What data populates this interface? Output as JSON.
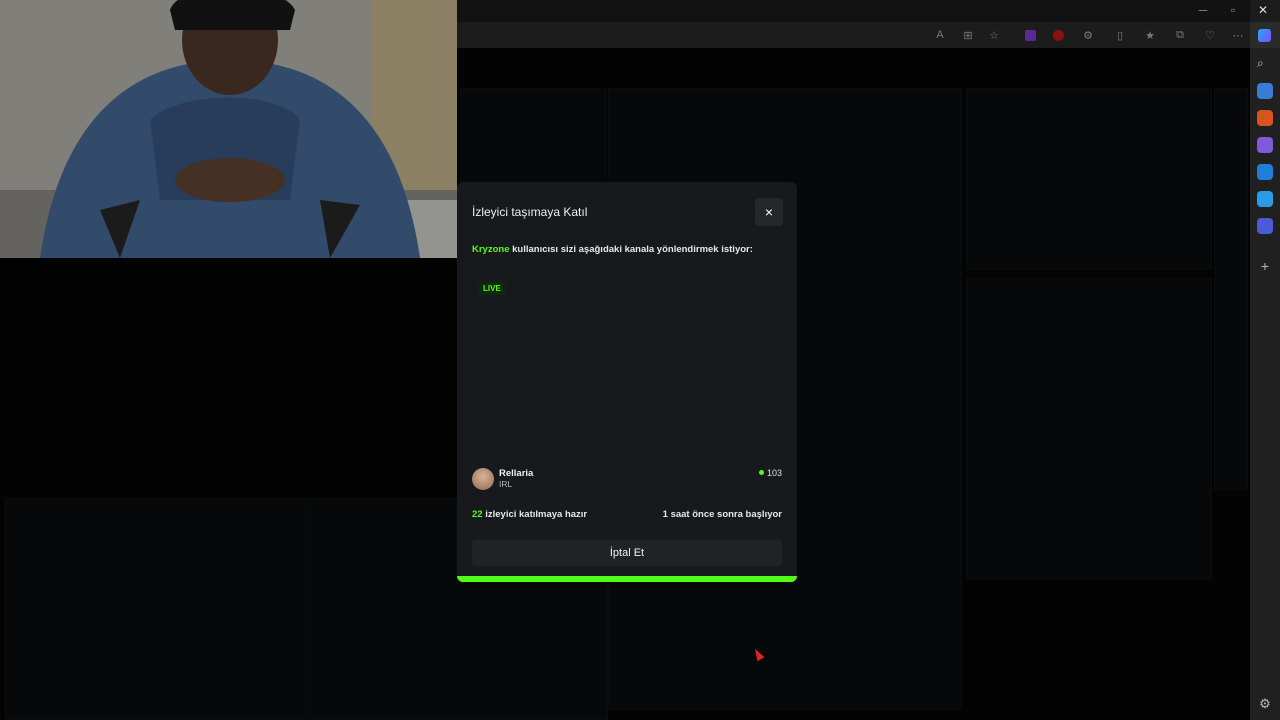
{
  "modal": {
    "title": "İzleyici taşımaya Katıl",
    "username": "Kryzone",
    "message": " kullanıcısı sizi aşağıdaki kanala yönlendirmek istiyor:",
    "live_badge": "LIVE",
    "channel_name": "Rellaria",
    "channel_category": "IRL",
    "viewer_count": "103",
    "ready_count": "22",
    "ready_text": " izleyici katılmaya hazır",
    "start_text": "1 saat önce sonra başlıyor",
    "cancel_label": "İptal Et",
    "close_icon": "×"
  },
  "colors": {
    "accent": "#53fc18",
    "modal_bg": "#18191c",
    "cursor": "#e0261c"
  },
  "icons": [
    "close-icon",
    "viewer-dot-icon",
    "mouse-cursor-icon",
    "minimize-icon",
    "maximize-icon",
    "window-close-icon"
  ]
}
